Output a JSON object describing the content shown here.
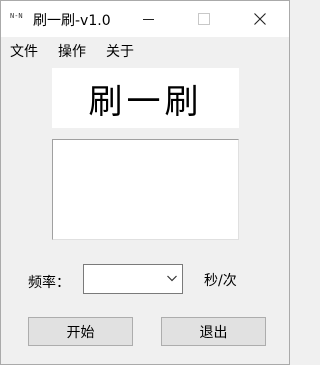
{
  "window": {
    "app_icon_text": "N-N",
    "title": "刷一刷-v1.0"
  },
  "menu": {
    "items": [
      "文件",
      "操作",
      "关于"
    ]
  },
  "banner": {
    "text": "刷一刷"
  },
  "content": {
    "text_area_value": ""
  },
  "frequency": {
    "label": "频率：",
    "selected": "",
    "unit": "秒/次"
  },
  "buttons": {
    "start": "开始",
    "exit": "退出"
  },
  "icons": {
    "minimize": "minimize-icon",
    "maximize": "maximize-icon",
    "close": "close-icon",
    "dropdown": "chevron-down-icon"
  }
}
